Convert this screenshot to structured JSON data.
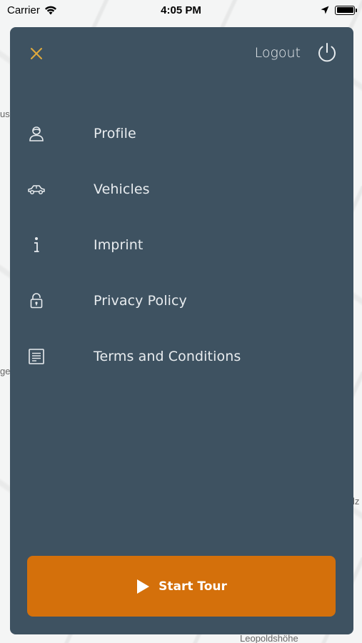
{
  "status_bar": {
    "carrier": "Carrier",
    "time": "4:05 PM"
  },
  "map": {
    "labels": [
      "us",
      "ge",
      "lz",
      "Leopoldshöhe"
    ]
  },
  "drawer": {
    "logout_label": "Logout",
    "menu_items": [
      {
        "label": "Profile",
        "icon": "profile-icon"
      },
      {
        "label": "Vehicles",
        "icon": "car-icon"
      },
      {
        "label": "Imprint",
        "icon": "info-icon"
      },
      {
        "label": "Privacy Policy",
        "icon": "lock-icon"
      },
      {
        "label": "Terms and Conditions",
        "icon": "document-icon"
      }
    ],
    "start_button_label": "Start Tour"
  },
  "colors": {
    "drawer_bg": "#3e5261",
    "accent_orange": "#d4700b",
    "close_icon": "#e0a93c",
    "menu_text": "#e8ecef"
  }
}
